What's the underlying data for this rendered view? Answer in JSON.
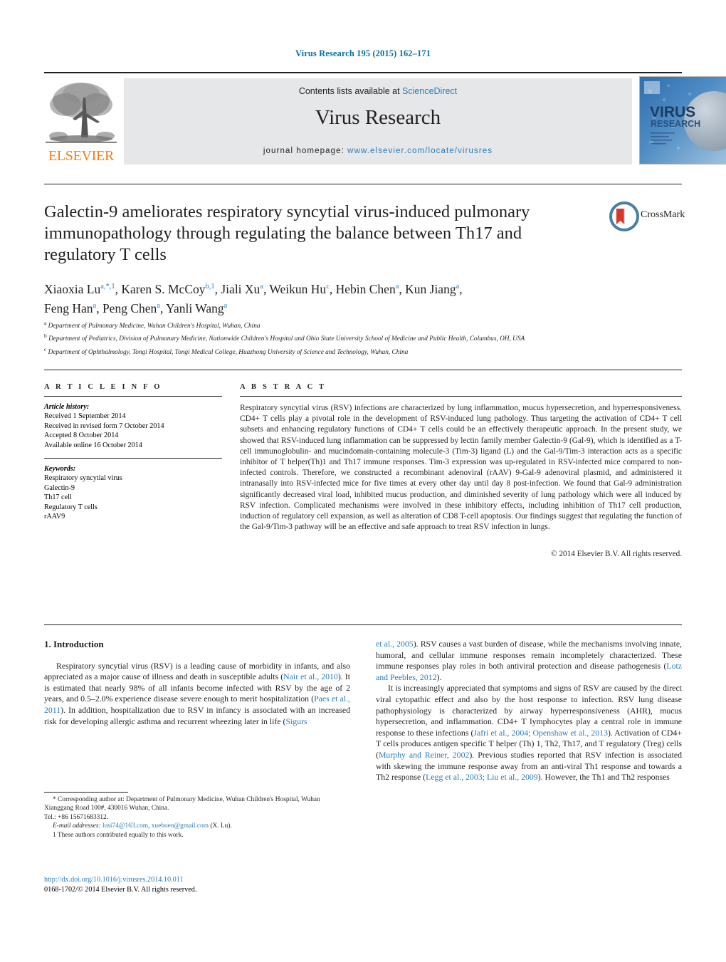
{
  "journal_ref": "Virus Research 195 (2015) 162–171",
  "masthead": {
    "contents_prefix": "Contents lists available at ",
    "sciencedirect": "ScienceDirect",
    "journal_title": "Virus Research",
    "homepage_prefix": "journal homepage: ",
    "homepage_url": "www.elsevier.com/locate/virusres",
    "elsevier_wordmark": "ELSEVIER",
    "cover_title_line1": "VIRUS",
    "cover_title_line2": "RESEARCH"
  },
  "crossmark": {
    "label": "CrossMark"
  },
  "article": {
    "title": "Galectin-9 ameliorates respiratory syncytial virus-induced pulmonary immunopathology through regulating the balance between Th17 and regulatory T cells",
    "authors_line1": "Xiaoxia Lu<sup>a,*,1</sup>, Karen S. McCoy<sup>b,1</sup>, Jiali Xu<sup>a</sup>, Weikun Hu<sup>c</sup>, Hebin Chen<sup>a</sup>, Kun Jiang<sup>a</sup>,",
    "authors_line2": "Feng Han<sup>a</sup>, Peng Chen<sup>a</sup>, Yanli Wang<sup>a</sup>",
    "affiliations": [
      "<sup>a</sup> Department of Pulmonary Medicine, Wuhan Children's Hospital, Wuhan, China",
      "<sup>b</sup> Department of Pediatrics, Division of Pulmonary Medicine, Nationwide Children's Hospital and Ohio State University School of Medicine and Public Health, Columbus, OH, USA",
      "<sup>c</sup> Department of Ophthalmology, Tongi Hospital, Tongi Medical College, Huazhong University of Science and Technology, Wuhan, China"
    ]
  },
  "article_info": {
    "heading": "A R T I C L E   I N F O",
    "history_label": "Article history:",
    "history": [
      "Received 1 September 2014",
      "Received in revised form 7 October 2014",
      "Accepted 8 October 2014",
      "Available online 16 October 2014"
    ],
    "keywords_label": "Keywords:",
    "keywords": [
      "Respiratory syncytial virus",
      "Galectin-9",
      "Th17 cell",
      "Regulatory T cells",
      "rAAV9"
    ]
  },
  "abstract": {
    "heading": "A B S T R A C T",
    "text": "Respiratory syncytial virus (RSV) infections are characterized by lung inflammation, mucus hypersecretion, and hyperresponsiveness. CD4+ T cells play a pivotal role in the development of RSV-induced lung pathology. Thus targeting the activation of CD4+ T cell subsets and enhancing regulatory functions of CD4+ T cells could be an effectively therapeutic approach. In the present study, we showed that RSV-induced lung inflammation can be suppressed by lectin family member Galectin-9 (Gal-9), which is identified as a T-cell immunoglobulin- and mucindomain-containing molecule-3 (Tim-3) ligand (L) and the Gal-9/Tim-3 interaction acts as a specific inhibitor of T helper(Th)1 and Th17 immune responses. Tim-3 expression was up-regulated in RSV-infected mice compared to non-infected controls. Therefore, we constructed a recombinant adenoviral (rAAV) 9-Gal-9 adenoviral plasmid, and administered it intranasally into RSV-infected mice for five times at every other day until day 8 post-infection. We found that Gal-9 administration significantly decreased viral load, inhibited mucus production, and diminished severity of lung pathology which were all induced by RSV infection. Complicated mechanisms were involved in these inhibitory effects, including inhibition of Th17 cell production, induction of regulatory cell expansion, as well as alteration of CD8 T-cell apoptosis. Our findings suggest that regulating the function of the Gal-9/Tim-3 pathway will be an effective and safe approach to treat RSV infection in lungs.",
    "copyright": "© 2014 Elsevier B.V. All rights reserved."
  },
  "introduction": {
    "section_title": "1.  Introduction",
    "left_html": "Respiratory syncytial virus (RSV) is a leading cause of morbidity in infants, and also appreciated as a major cause of illness and death in susceptible adults (<span class=\"cite\">Nair et al., 2010</span>). It is estimated that nearly 98% of all infants become infected with RSV by the age of 2 years, and 0.5–2.0% experience disease severe enough to merit hospitalization (<span class=\"cite\">Paes et al., 2011</span>). In addition, hospitalization due to RSV in infancy is associated with an increased risk for developing allergic asthma and recurrent wheezing later in life (<span class=\"cite\">Sigurs</span>",
    "right_html_p1": "<span class=\"cite\">et al., 2005</span>). RSV causes a vast burden of disease, while the mechanisms involving innate, humoral, and cellular immune responses remain incompletely characterized. These immune responses play roles in both antiviral protection and disease pathogenesis (<span class=\"cite\">Lotz and Peebles, 2012</span>).",
    "right_html_p2": "It is increasingly appreciated that symptoms and signs of RSV are caused by the direct viral cytopathic effect and also by the host response to infection. RSV lung disease pathophysiology is characterized by airway hyperresponsiveness (AHR), mucus hypersecretion, and inflammation. CD4+ T lymphocytes play a central role in immune response to these infections (<span class=\"cite\">Jafri et al., 2004; Openshaw et al., 2013</span>). Activation of CD4+ T cells produces antigen specific T helper (Th) 1, Th2, Th17, and T regulatory (Treg) cells (<span class=\"cite\">Murphy and Reiner, 2002</span>). Previous studies reported that RSV infection is associated with skewing the immune response away from an anti-viral Th1 response and towards a Th2 response (<span class=\"cite\">Legg et al., 2003; Liu et al., 2009</span>). However, the Th1 and Th2 responses"
  },
  "footnotes": {
    "corresponding": "* Corresponding author at: Department of Pulmonary Medicine, Wuhan Children's Hospital, Wuhan Xianggang Road 100#, 430016 Wuhan, China.",
    "tel": "Tel.: +86 15671683312.",
    "email_label": "E-mail addresses:",
    "email1": "lusi74@163.com",
    "email2": "xueboen@gmail.com",
    "email_suffix": "(X. Lu).",
    "equal_contrib": "1  These authors contributed equally to this work.",
    "doi": "http://dx.doi.org/10.1016/j.virusres.2014.10.011",
    "issn_line": "0168-1702/© 2014 Elsevier B.V. All rights reserved."
  },
  "colors": {
    "link_blue": "#2b7bb9",
    "journal_ref_blue": "#0a6ea1",
    "elsevier_orange": "#f07f13",
    "grey_band": "#e6e7e8",
    "text": "#231f20"
  }
}
